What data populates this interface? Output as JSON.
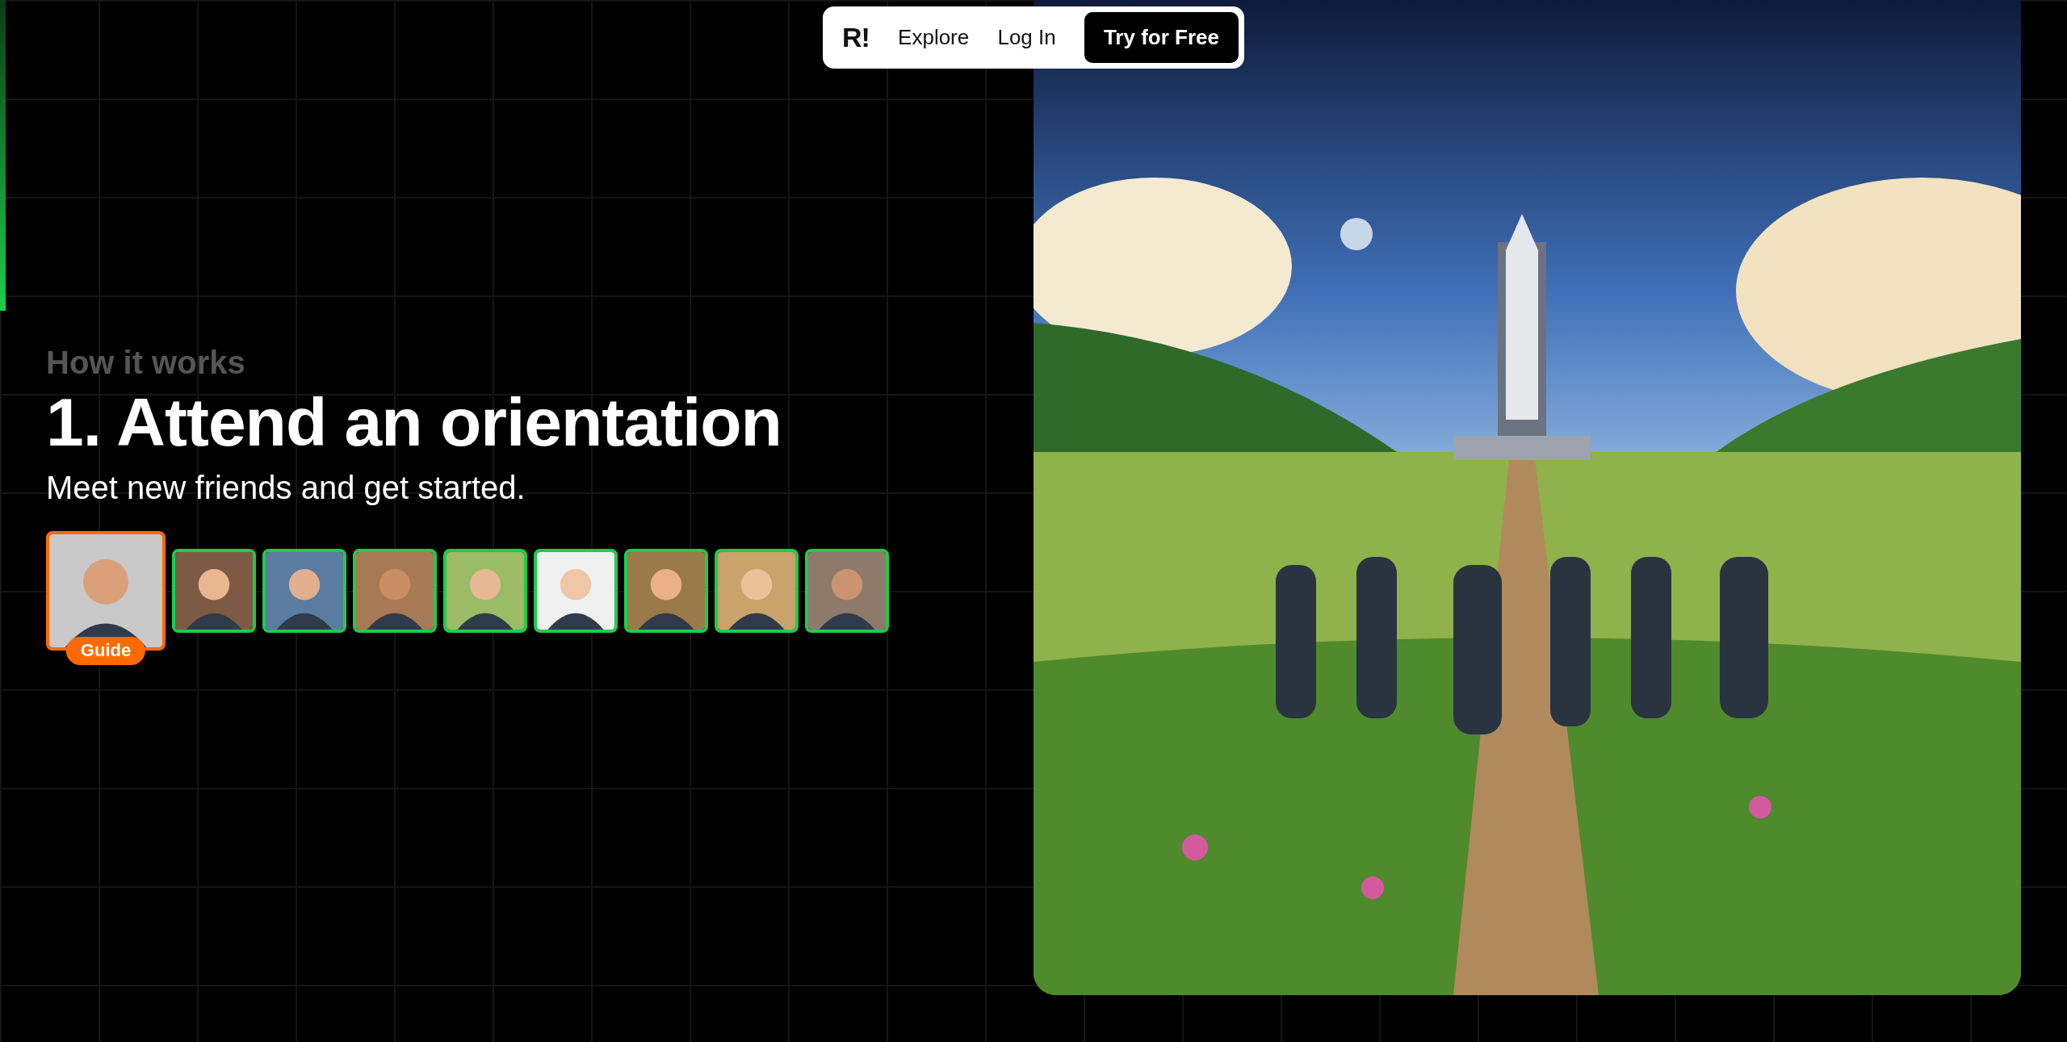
{
  "nav": {
    "logo": "R!",
    "links": [
      {
        "label": "Explore"
      },
      {
        "label": "Log In"
      }
    ],
    "cta": "Try for Free"
  },
  "section": {
    "eyebrow": "How it works",
    "title": "1. Attend an orientation",
    "subtitle": "Meet new friends and get started.",
    "avatars": [
      {
        "kind": "guide",
        "badge": "Guide"
      },
      {
        "kind": "member"
      },
      {
        "kind": "member"
      },
      {
        "kind": "member"
      },
      {
        "kind": "member"
      },
      {
        "kind": "member"
      },
      {
        "kind": "member"
      },
      {
        "kind": "member"
      },
      {
        "kind": "member"
      }
    ]
  }
}
